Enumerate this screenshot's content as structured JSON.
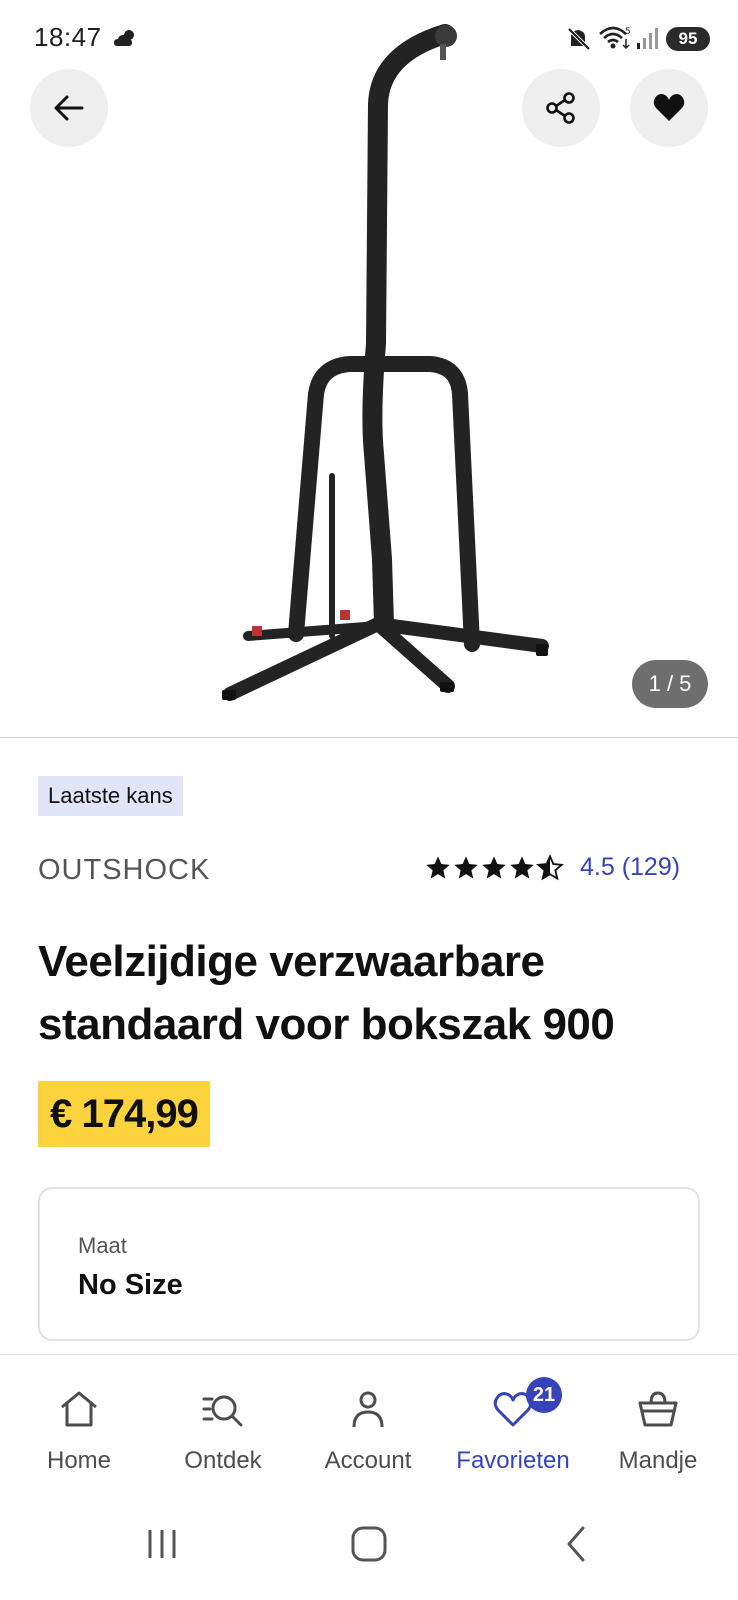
{
  "status_bar": {
    "time": "18:47",
    "battery": "95"
  },
  "hero": {
    "image_counter": "1 / 5"
  },
  "product": {
    "tag": "Laatste kans",
    "brand": "OUTSHOCK",
    "rating_value": 4.5,
    "rating_text": "4.5 (129)",
    "title": "Veelzijdige verzwaarbare standaard voor bokszak 900",
    "price": "€ 174,99"
  },
  "size": {
    "label": "Maat",
    "value": "No Size"
  },
  "nav": {
    "items": [
      {
        "label": "Home",
        "icon": "home-icon"
      },
      {
        "label": "Ontdek",
        "icon": "discover-icon"
      },
      {
        "label": "Account",
        "icon": "account-icon"
      },
      {
        "label": "Favorieten",
        "icon": "heart-icon"
      },
      {
        "label": "Mandje",
        "icon": "basket-icon"
      }
    ],
    "active": "Favorieten",
    "favorites_count": "21"
  },
  "colors": {
    "accent": "#3643ba",
    "price_bg": "#fdd33d",
    "tag_bg": "#e2e4f8"
  }
}
